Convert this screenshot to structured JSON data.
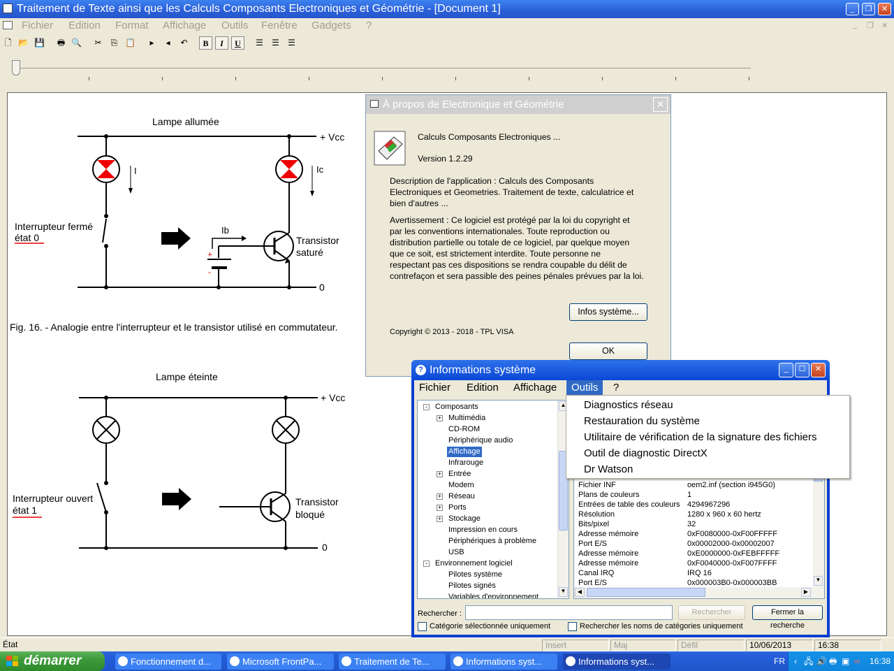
{
  "main_window": {
    "title": "Traitement de Texte ainsi que les Calculs Composants Electroniques et Géométrie - [Document 1]",
    "menu": [
      "Fichier",
      "Edition",
      "Format",
      "Affichage",
      "Outils",
      "Fenêtre",
      "Gadgets",
      "?"
    ]
  },
  "toolbar": {
    "bold": "B",
    "italic": "I",
    "underline": "U"
  },
  "document": {
    "fig16": {
      "title": "Lampe allumée",
      "vcc": "+ Vcc",
      "zero": "0",
      "i": "I",
      "ic": "Ic",
      "ib": "Ib",
      "switch_label": "Interrupteur fermé",
      "state": "état  0",
      "transistor": "Transistor",
      "transistor_state": "saturé",
      "caption": "Fig. 16. - Analogie entre l'interrupteur et le transistor utilisé en commutateur."
    },
    "fig2": {
      "title": "Lampe éteinte",
      "vcc": "+ Vcc",
      "zero": "0",
      "switch_label": "Interrupteur ouvert",
      "state": "état  1",
      "transistor": "Transistor",
      "transistor_state": "bloqué"
    }
  },
  "about_dialog": {
    "title": "À propos de Electronique et Géométrie",
    "product": "Calculs Composants Electroniques ...",
    "version": "Version 1.2.29",
    "description": [
      "Description de l'application : Calculs des Composants",
      "Electroniques et Geometries. Traitement de texte, calculatrice et",
      "bien d'autres ..."
    ],
    "warning": [
      "Avertissement : Ce logiciel est protégé par la loi du copyright et",
      "par les conventions internationales. Toute reproduction ou",
      "distribution partielle ou totale de ce logiciel, par quelque moyen",
      "que ce soit, est strictement interdite. Toute personne ne",
      "respectant pas ces dispositions se rendra coupable du délit de",
      "contrefaçon et sera passible des peines pénales prévues par la loi."
    ],
    "sysinfo_button": "Infos système...",
    "copyright": "Copyright © 2013 - 2018 - TPL VISA",
    "ok_button": "OK"
  },
  "sysinfo": {
    "title": "Informations système",
    "menu": [
      "Fichier",
      "Edition",
      "Affichage",
      "Outils",
      "?"
    ],
    "tree": [
      {
        "label": "Composants",
        "level": 0,
        "toggle": "-"
      },
      {
        "label": "Multimédia",
        "level": 1,
        "toggle": "+"
      },
      {
        "label": "CD-ROM",
        "level": 1,
        "toggle": ""
      },
      {
        "label": "Périphérique audio",
        "level": 1,
        "toggle": ""
      },
      {
        "label": "Affichage",
        "level": 1,
        "toggle": "",
        "selected": true
      },
      {
        "label": "Infrarouge",
        "level": 1,
        "toggle": ""
      },
      {
        "label": "Entrée",
        "level": 1,
        "toggle": "+"
      },
      {
        "label": "Modem",
        "level": 1,
        "toggle": ""
      },
      {
        "label": "Réseau",
        "level": 1,
        "toggle": "+"
      },
      {
        "label": "Ports",
        "level": 1,
        "toggle": "+"
      },
      {
        "label": "Stockage",
        "level": 1,
        "toggle": "+"
      },
      {
        "label": "Impression en cours",
        "level": 1,
        "toggle": ""
      },
      {
        "label": "Périphériques à problème",
        "level": 1,
        "toggle": ""
      },
      {
        "label": "USB",
        "level": 1,
        "toggle": ""
      },
      {
        "label": "Environnement logiciel",
        "level": 0,
        "toggle": "-"
      },
      {
        "label": "Pilotes système",
        "level": 1,
        "toggle": ""
      },
      {
        "label": "Pilotes signés",
        "level": 1,
        "toggle": ""
      },
      {
        "label": "Variables d'environnement",
        "level": 1,
        "toggle": ""
      }
    ],
    "details": [
      {
        "item": "Fichier INF",
        "value": "oem2.inf (section i945G0)"
      },
      {
        "item": "Plans de couleurs",
        "value": "1"
      },
      {
        "item": "Entrées de table des couleurs",
        "value": "4294967296"
      },
      {
        "item": "Résolution",
        "value": "1280 x 960 x 60 hertz"
      },
      {
        "item": "Bits/pixel",
        "value": "32"
      },
      {
        "item": "Adresse mémoire",
        "value": "0xF0080000-0xF00FFFFF"
      },
      {
        "item": "Port E/S",
        "value": "0x00002000-0x00002007"
      },
      {
        "item": "Adresse mémoire",
        "value": "0xE0000000-0xFEBFFFFF"
      },
      {
        "item": "Adresse mémoire",
        "value": "0xF0040000-0xF007FFFF"
      },
      {
        "item": "Canal IRQ",
        "value": "IRQ 16"
      },
      {
        "item": "Port E/S",
        "value": "0x000003B0-0x000003BB"
      }
    ],
    "search_label": "Rechercher :",
    "search_value": "",
    "search_button": "Rechercher",
    "close_search_button": "Fermer la recherche",
    "check_selected": "Catégorie sélectionnée uniquement",
    "check_names": "Rechercher les noms de catégories uniquement",
    "tools_menu": [
      "Diagnostics réseau",
      "Restauration du système",
      "Utilitaire de vérification de la signature des fichiers",
      "Outil de diagnostic DirectX",
      "Dr Watson"
    ]
  },
  "statusbar": {
    "state": "État",
    "insert": "Insert",
    "caps": "Maj",
    "scroll": "Défil",
    "date": "10/06/2013",
    "time": "16:38"
  },
  "taskbar": {
    "start": "démarrer",
    "tasks": [
      "Fonctionnement d...",
      "Microsoft FrontPa...",
      "Traitement de Te...",
      "Informations syst...",
      "Informations syst..."
    ],
    "lang": "FR",
    "clock": "16:38"
  }
}
